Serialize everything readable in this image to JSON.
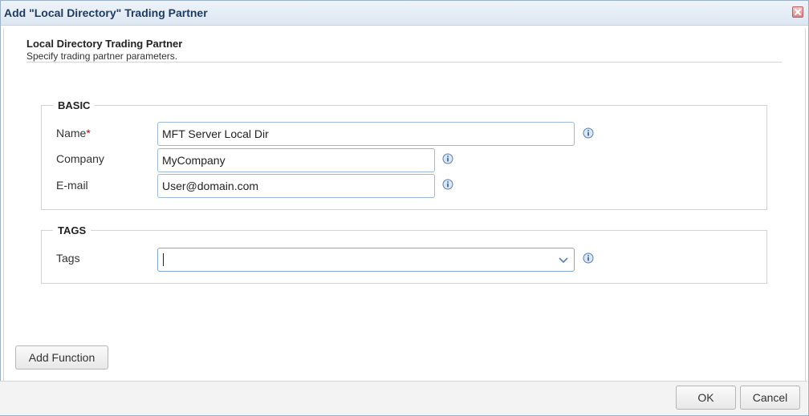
{
  "window": {
    "title": "Add \"Local Directory\" Trading Partner"
  },
  "header": {
    "title": "Local Directory Trading Partner",
    "subtitle": "Specify trading partner parameters."
  },
  "basic": {
    "legend": "BASIC",
    "name": {
      "label": "Name",
      "required_mark": "*",
      "value": "MFT Server Local Dir"
    },
    "company": {
      "label": "Company",
      "value": "MyCompany"
    },
    "email": {
      "label": "E-mail",
      "value": "User@domain.com"
    }
  },
  "tags": {
    "legend": "TAGS",
    "label": "Tags",
    "value": ""
  },
  "buttons": {
    "add_function": "Add Function",
    "ok": "OK",
    "cancel": "Cancel"
  },
  "icons": {
    "close": "close-icon",
    "info": "info-icon",
    "dropdown": "chevron-down-icon"
  },
  "colors": {
    "title_text": "#1f3a5f",
    "input_border": "#9bb8d6",
    "required": "#cc0000"
  }
}
